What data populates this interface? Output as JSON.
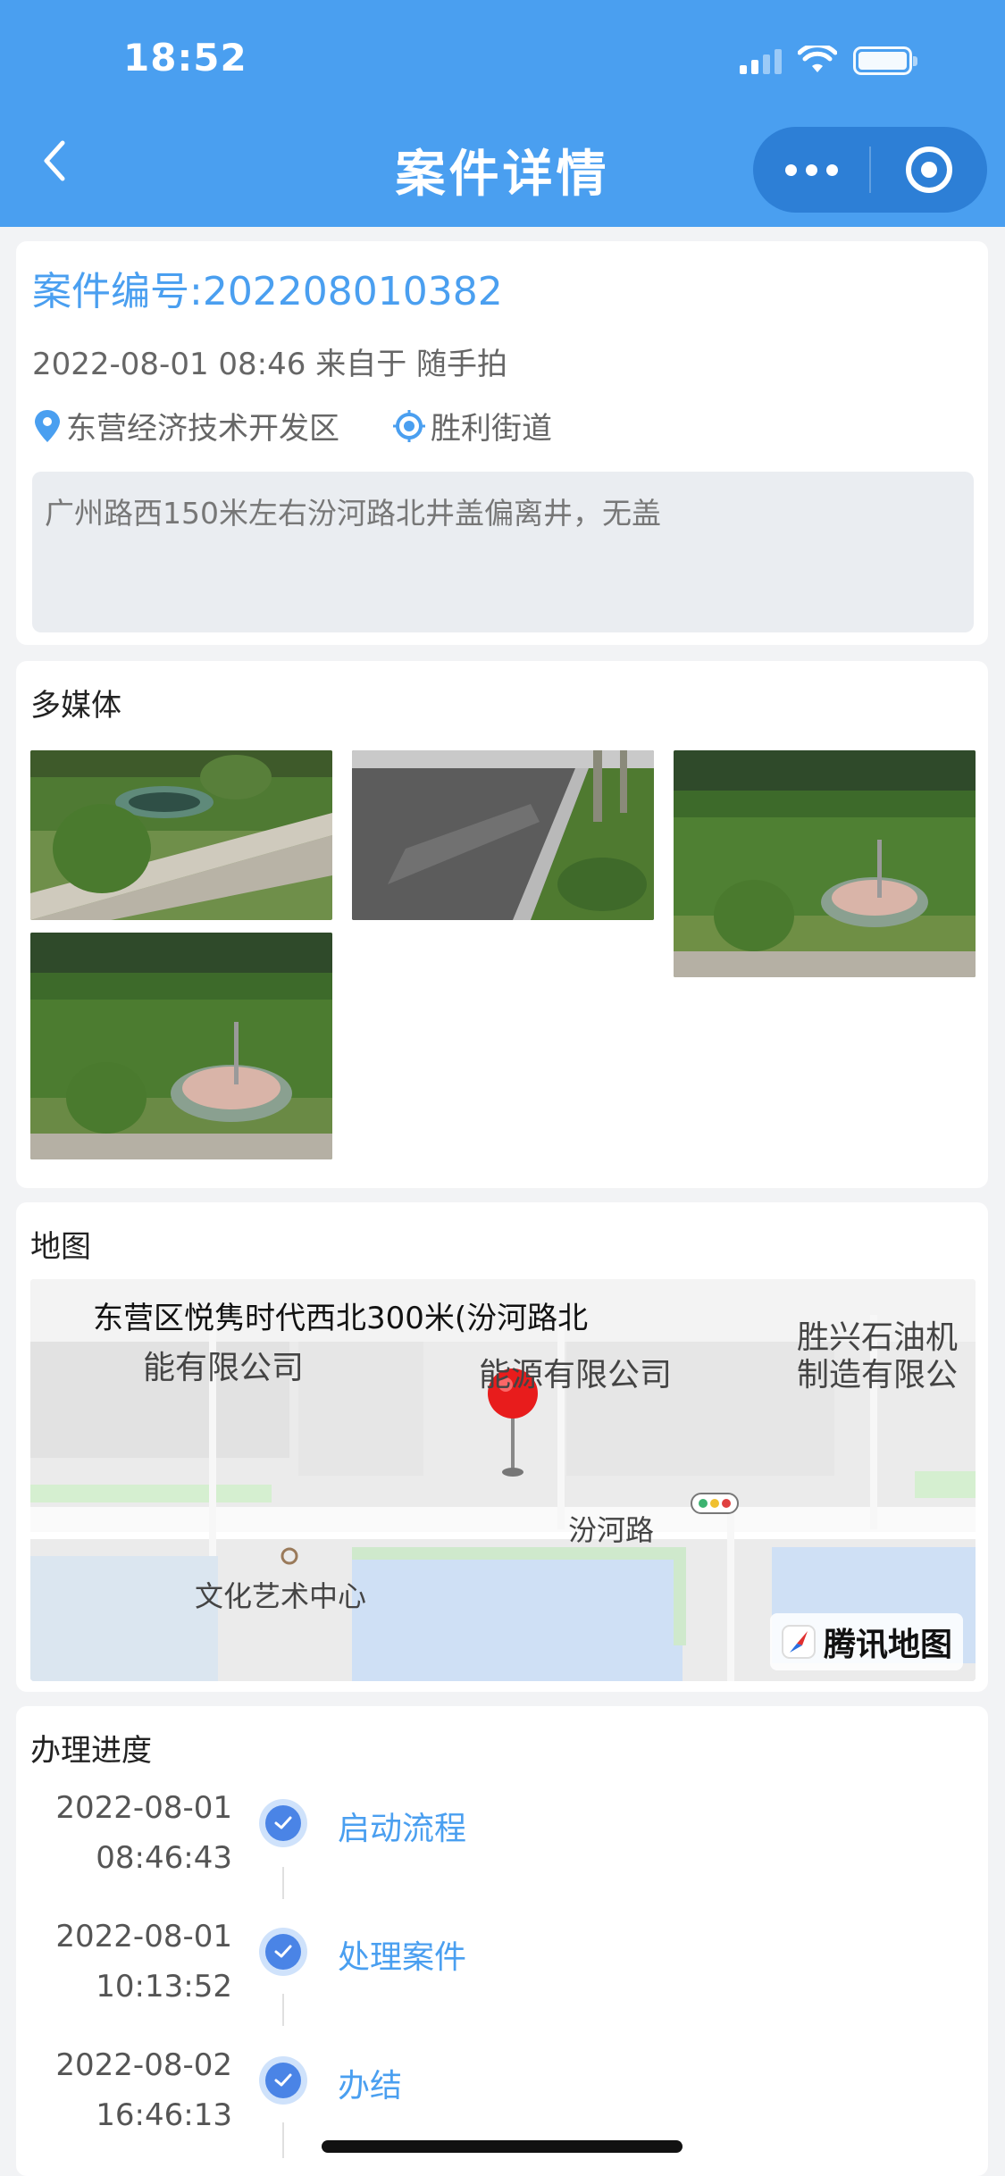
{
  "status_bar": {
    "time": "18:52"
  },
  "nav": {
    "title": "案件详情"
  },
  "case": {
    "number": "案件编号:202208010382",
    "meta": "2022-08-01 08:46 来自于 随手拍",
    "district": "东营经济技术开发区",
    "street": "胜利街道",
    "description": "广州路西150米左右汾河路北井盖偏离井，无盖"
  },
  "media": {
    "title": "多媒体"
  },
  "map": {
    "title": "地图",
    "address_bubble": "东营区悦隽时代西北300米(汾河路北",
    "labels": [
      "能有限公司",
      "能源有限公司",
      "胜兴石油机",
      "制造有限公",
      "汾河路",
      "文化艺术中心"
    ],
    "provider": "腾讯地图"
  },
  "progress": {
    "title": "办理进度",
    "steps": [
      {
        "date": "2022-08-01",
        "time": "08:46:43",
        "name": "启动流程"
      },
      {
        "date": "2022-08-01",
        "time": "10:13:52",
        "name": "处理案件"
      },
      {
        "date": "2022-08-02",
        "time": "16:46:13",
        "name": "办结"
      }
    ]
  },
  "colors": {
    "header_blue": "#4a9ff0",
    "accent_blue": "#4a9ff0",
    "check_blue": "#4a84e6"
  }
}
